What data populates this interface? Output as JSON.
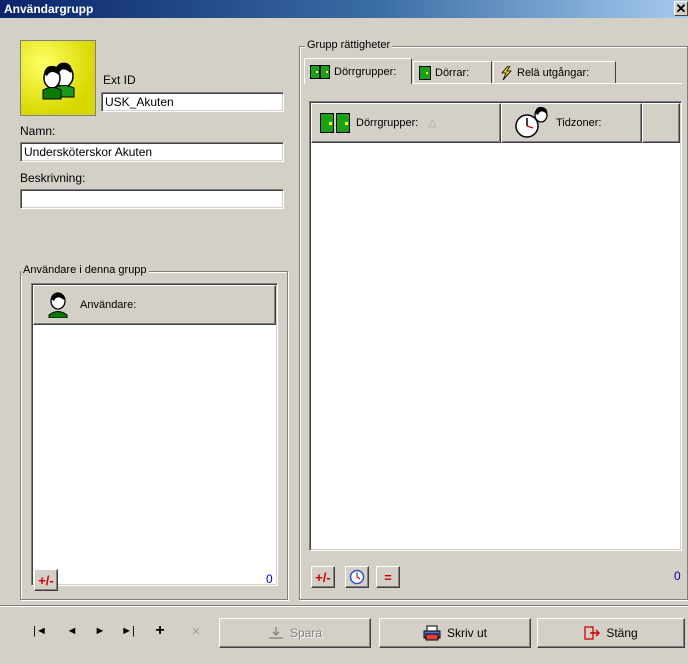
{
  "window": {
    "title": "Användargrupp",
    "close_glyph": "✕"
  },
  "identity": {
    "ext_id_label": "Ext ID",
    "ext_id_value": "USK_Akuten",
    "name_label": "Namn:",
    "name_value": "Undersköterskor Akuten",
    "description_label": "Beskrivning:",
    "description_value": ""
  },
  "users_group": {
    "label": "Användare i denna grupp",
    "column_header": "Användare:",
    "add_remove_label": "+/-",
    "count": "0"
  },
  "rights_group": {
    "label": "Grupp rättigheter",
    "tabs": [
      {
        "label": "Dörrgrupper:",
        "icon": "door-group-icon",
        "active": true
      },
      {
        "label": "Dörrar:",
        "icon": "door-icon",
        "active": false
      },
      {
        "label": "Relä utgångar:",
        "icon": "relay-icon",
        "active": false
      }
    ],
    "columns": [
      {
        "label": "Dörrgrupper:",
        "sort_glyph": "△"
      },
      {
        "label": "Tidzoner:"
      }
    ],
    "add_remove_label": "+/-",
    "equals_label": "=",
    "count": "0"
  },
  "navigation": {
    "first": "|◄",
    "prev": "◄",
    "next": "►",
    "last": "►|",
    "add": "+",
    "delete": "✕"
  },
  "actions": {
    "save_label": "Spara",
    "print_label": "Skriv ut",
    "close_label": "Stäng"
  },
  "colors": {
    "title_start": "#0a246a",
    "face": "#d4d0c8",
    "avatar_bg": "#e8e800",
    "count_color": "#0000c0",
    "accent_red": "#d00000"
  }
}
